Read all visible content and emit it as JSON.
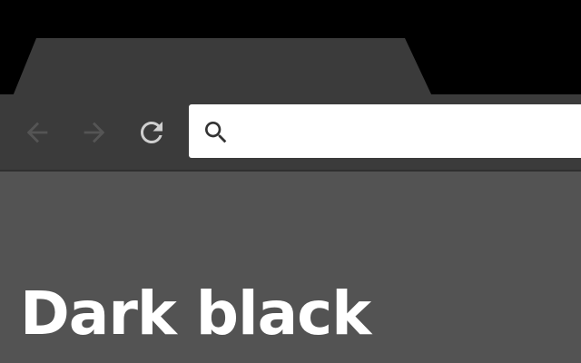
{
  "browser": {
    "tab": {
      "title": ""
    },
    "toolbar": {
      "back_icon": "arrow-left-icon",
      "forward_icon": "arrow-right-icon",
      "reload_icon": "reload-icon",
      "omnibox": {
        "icon": "search-icon",
        "value": "",
        "placeholder": ""
      }
    }
  },
  "content": {
    "headline": "Dark black"
  },
  "colors": {
    "tabstrip_background": "#000000",
    "tab_background": "#3b3b3b",
    "toolbar_background": "#3b3b3b",
    "content_background": "#535353",
    "omnibox_background": "#ffffff",
    "headline_text": "#ffffff",
    "disabled_nav_icon": "#555555",
    "reload_icon": "#cfcfcf"
  }
}
